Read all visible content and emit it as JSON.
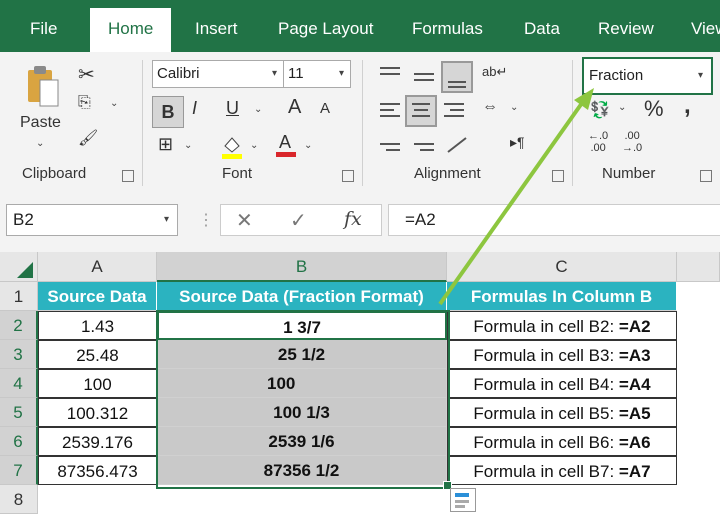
{
  "tabs": [
    "File",
    "Home",
    "Insert",
    "Page Layout",
    "Formulas",
    "Data",
    "Review",
    "View"
  ],
  "ribbon": {
    "clipboard": {
      "paste_label": "Paste",
      "group_label": "Clipboard"
    },
    "font": {
      "name": "Calibri",
      "size": "11",
      "group_label": "Font",
      "bold": "B",
      "italic": "I",
      "underline": "U",
      "grow": "A",
      "shrink": "A"
    },
    "alignment": {
      "group_label": "Alignment"
    },
    "number": {
      "format": "Fraction",
      "group_label": "Number",
      "percent": "%",
      "comma": ","
    }
  },
  "formula_bar": {
    "name_box": "B2",
    "fx": "fx",
    "formula": "=A2"
  },
  "columns": [
    "A",
    "B",
    "C"
  ],
  "rows": [
    "1",
    "2",
    "3",
    "4",
    "5",
    "6",
    "7",
    "8"
  ],
  "headers": {
    "a": "Source Data",
    "b": "Source Data (Fraction Format)",
    "c": "Formulas In Column B"
  },
  "data": [
    {
      "a": "1.43",
      "b": "1 3/7",
      "c_text": "Formula in cell B2: ",
      "c_ref": "=A2"
    },
    {
      "a": "25.48",
      "b": "25 1/2",
      "c_text": "Formula in cell B3: ",
      "c_ref": "=A3"
    },
    {
      "a": "100",
      "b": "100",
      "c_text": "Formula in cell B4: ",
      "c_ref": "=A4"
    },
    {
      "a": "100.312",
      "b": "100 1/3",
      "c_text": "Formula in cell B5: ",
      "c_ref": "=A5"
    },
    {
      "a": "2539.176",
      "b": "2539 1/6",
      "c_text": "Formula in cell B6: ",
      "c_ref": "=A6"
    },
    {
      "a": "87356.473",
      "b": "87356 1/2",
      "c_text": "Formula in cell B7: ",
      "c_ref": "=A7"
    }
  ],
  "colors": {
    "excel_green": "#217346",
    "header_teal": "#2bb3c0",
    "arrow_green": "#8dc63f",
    "selection_grey": "#c9c9c9"
  }
}
